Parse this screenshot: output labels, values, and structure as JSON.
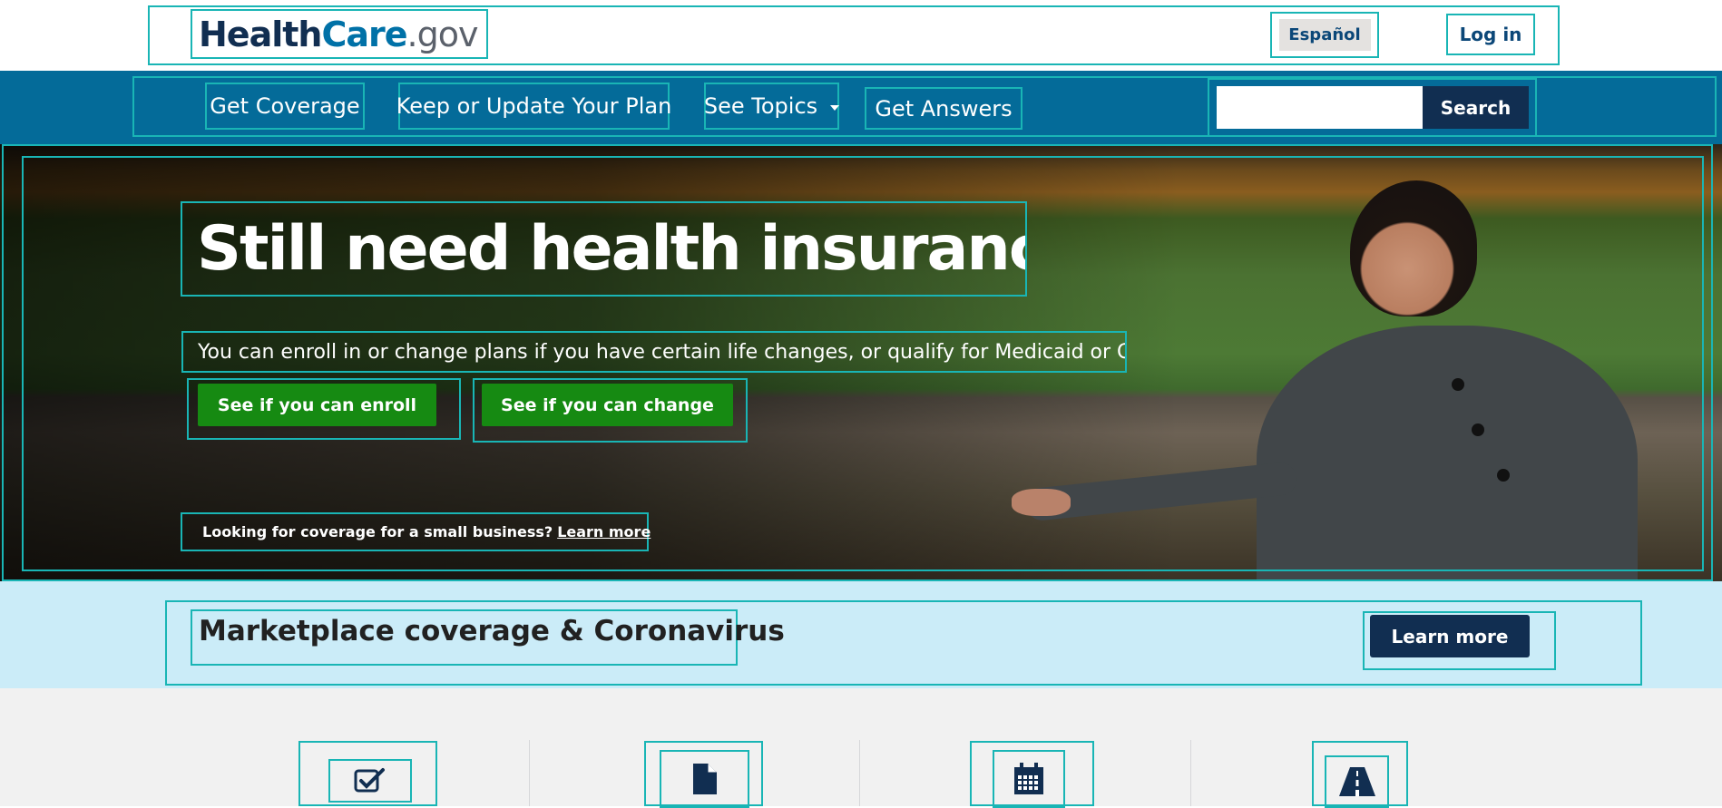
{
  "header": {
    "logo": {
      "part1": "Health",
      "part2": "Care",
      "part3": ".gov"
    },
    "language_label": "Español",
    "login_label": "Log in"
  },
  "nav": {
    "items": [
      {
        "label": "Get Coverage"
      },
      {
        "label": "Keep or Update Your Plan"
      },
      {
        "label": "See Topics",
        "has_dropdown": true
      },
      {
        "label": "Get Answers"
      }
    ],
    "search": {
      "value": "",
      "button_label": "Search"
    }
  },
  "hero": {
    "title": "Still need health insurance?",
    "subtitle": "You can enroll in or change plans if you have certain life changes, or qualify for Medicaid or CHIP.",
    "enroll_button": "See if you can enroll",
    "change_button": "See if you can change",
    "small_business_text": "Looking for coverage for a small business?",
    "small_business_link": "Learn more"
  },
  "covid_banner": {
    "title": "Marketplace coverage & Coronavirus",
    "button_label": "Learn more"
  },
  "cards": {
    "icons": [
      "checkbox-icon",
      "document-icon",
      "calendar-icon",
      "road-icon"
    ]
  },
  "colors": {
    "nav_bg": "#046b99",
    "brand_navy": "#112e51",
    "brand_blue": "#0071a7",
    "cta_green": "#168a12",
    "banner_bg": "#cbecf8",
    "annotation_outline": "#19b5b5"
  }
}
